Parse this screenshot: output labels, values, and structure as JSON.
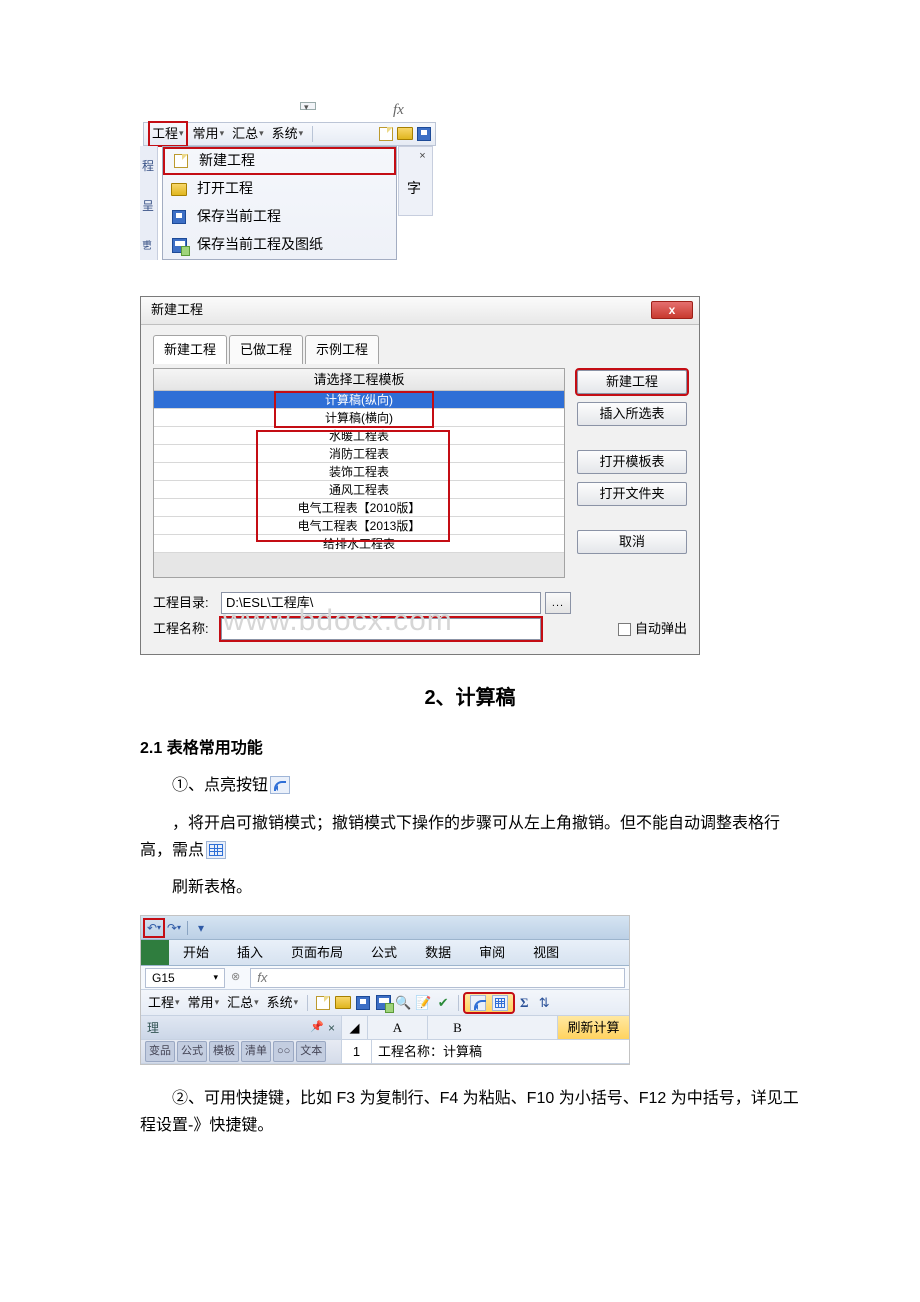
{
  "shot1": {
    "fx": "fx",
    "menu": {
      "gongcheng": "工程",
      "changyong": "常用",
      "huizong": "汇总",
      "xitong": "系统",
      "caret": "▾"
    },
    "left_pane": {
      "c1": "程",
      "c2": "呈",
      "c3": "乶"
    },
    "dropdown": {
      "new_project": "新建工程",
      "open_project": "打开工程",
      "save_project": "保存当前工程",
      "save_project_drawings": "保存当前工程及图纸"
    },
    "side": {
      "close": "×",
      "zi": "字"
    }
  },
  "dialog": {
    "title": "新建工程",
    "close_x": "x",
    "tabs": {
      "t1": "新建工程",
      "t2": "已做工程",
      "t3": "示例工程"
    },
    "header": "请选择工程模板",
    "templates": [
      "计算稿(纵向)",
      "计算稿(横向)",
      "水暖工程表",
      "消防工程表",
      "装饰工程表",
      "通风工程表",
      "电气工程表【2010版】",
      "电气工程表【2013版】",
      "给排水工程表"
    ],
    "buttons": {
      "new": "新建工程",
      "insert": "插入所选表",
      "open_tpl": "打开模板表",
      "open_folder": "打开文件夹",
      "cancel": "取消"
    },
    "dir_label": "工程目录:",
    "dir_value": "D:\\ESL\\工程库\\",
    "name_label": "工程名称:",
    "name_value": "",
    "browse": "...",
    "auto_popup": "自动弹出",
    "watermark": "www.bdocx.com"
  },
  "heading2": "2、计算稿",
  "h3_21": "2.1 表格常用功能",
  "p1": "①、点亮按钮",
  "p2": "，将开启可撤销模式；撤销模式下操作的步骤可从左上角撤销。但不能自动调整表格行高，需点",
  "p3": "刷新表格。",
  "shot3": {
    "qat_undo": "↶",
    "qat_redo": "↷",
    "ribbon": [
      "开始",
      "插入",
      "页面布局",
      "公式",
      "数据",
      "审阅",
      "视图"
    ],
    "namebox": "G15",
    "fx": "fx",
    "menu": {
      "gongcheng": "工程",
      "changyong": "常用",
      "huizong": "汇总",
      "xitong": "系统",
      "caret": "▾"
    },
    "sigma": "Σ",
    "left_pane_label": "理",
    "pin": "📌",
    "pin_close": "×",
    "col_A": "A",
    "col_B": "B",
    "refresh": "刷新计算",
    "tabstrip": [
      "变品",
      "公式",
      "模板",
      "清单",
      "○○",
      "文本"
    ],
    "rownum": "1",
    "proj_name_label": "工程名称：计算稿"
  },
  "p4": "②、可用快捷键，比如 F3 为复制行、F4 为粘贴、F10 为小括号、F12 为中括号，详见工程设置-》快捷键。"
}
